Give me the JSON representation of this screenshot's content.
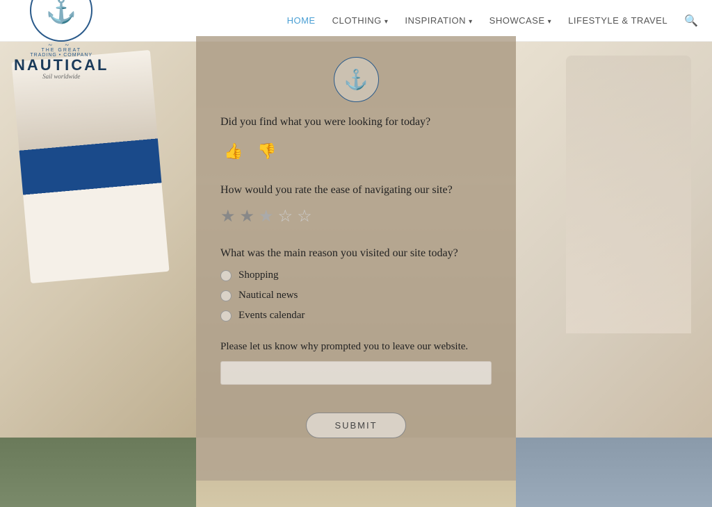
{
  "nav": {
    "logo": {
      "birds": "✦ ✦",
      "text_top": "THE GREAT",
      "trading": "TRADING • COMPANY",
      "nautical": "NAUTICAL",
      "tagline": "Sail worldwide"
    },
    "links": [
      {
        "label": "HOME",
        "active": true,
        "has_arrow": false
      },
      {
        "label": "CLOTHING",
        "active": false,
        "has_arrow": true
      },
      {
        "label": "INSPIRATION",
        "active": false,
        "has_arrow": true
      },
      {
        "label": "SHOWCASE",
        "active": false,
        "has_arrow": true
      },
      {
        "label": "LIFESTYLE & TRAVEL",
        "active": false,
        "has_arrow": false
      }
    ],
    "search_icon": "🔍"
  },
  "modal": {
    "question1": "Did you find what you were looking for today?",
    "thumbs_up": "👍",
    "thumbs_down": "👎",
    "question2": "How would you rate the ease of navigating our site?",
    "stars": [
      {
        "filled": true
      },
      {
        "filled": true
      },
      {
        "filled": false,
        "half": true
      },
      {
        "filled": false
      },
      {
        "filled": false
      }
    ],
    "question3": "What was the main reason you visited our site today?",
    "radio_options": [
      {
        "label": "Shopping"
      },
      {
        "label": "Nautical news"
      },
      {
        "label": "Events calendar"
      }
    ],
    "question4": "Please let us know why prompted you to leave our website.",
    "input_placeholder": "",
    "submit_label": "SUBMIT"
  }
}
